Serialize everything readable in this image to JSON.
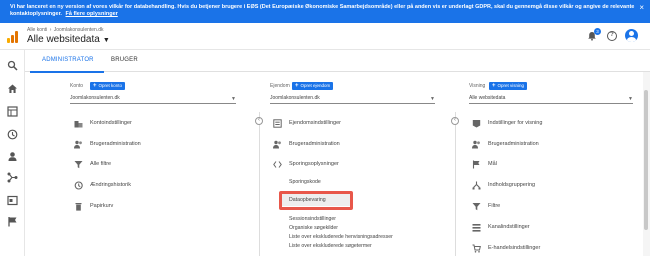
{
  "banner": {
    "text": "Vi har lanceret en ny version af vores vilkår for databehandling. Hvis du betjener brugere i EØS (Det Europæiske Økonomiske Samarbejdsområde) eller på anden vis er underlagt GDPR, skal du gennemgå disse vilkår og angive de relevante kontaktoplysninger.",
    "link": "Få flere oplysninger",
    "close": "×"
  },
  "header": {
    "breadcrumb": [
      "Alle konti",
      "Joomlakonsulenten.dk"
    ],
    "title": "Alle websitedata",
    "notification_count": "3",
    "help": "?"
  },
  "tabs": [
    {
      "label": "ADMINISTRATOR"
    },
    {
      "label": "BRUGER"
    }
  ],
  "columns": {
    "konto": {
      "heading": "Konto",
      "button": "Opret konto",
      "selected": "Joomlakonsulenten.dk",
      "items": [
        "Kontoindstillinger",
        "Brugeradministration",
        "Alle filtre",
        "Ændringshistorik",
        "Papirkurv"
      ]
    },
    "ejendom": {
      "heading": "Ejendom",
      "button": "Opret ejendom",
      "selected": "Joomlakonsulenten.dk",
      "items": [
        "Ejendomsindstillinger",
        "Brugeradministration",
        "Sporingsoplysninger"
      ],
      "subitems": [
        "Sporingskode",
        "Dataopbevaring",
        "Sessionsindstillinger",
        "Organiske søgekilder",
        "Liste over ekskluderede henvisningsadresser",
        "Liste over ekskluderede søgetermer"
      ]
    },
    "visning": {
      "heading": "Visning",
      "button": "Opret visning",
      "selected": "Alle websitedata",
      "items": [
        "Indstillinger for visning",
        "Brugeradministration",
        "Mål",
        "Indholdsgruppering",
        "Filtre",
        "Kanalindstillinger",
        "E-handelsindstillinger"
      ]
    }
  },
  "colors": {
    "accent": "#1a73e8",
    "highlight": "#e8574a",
    "logo": "#e37400"
  }
}
